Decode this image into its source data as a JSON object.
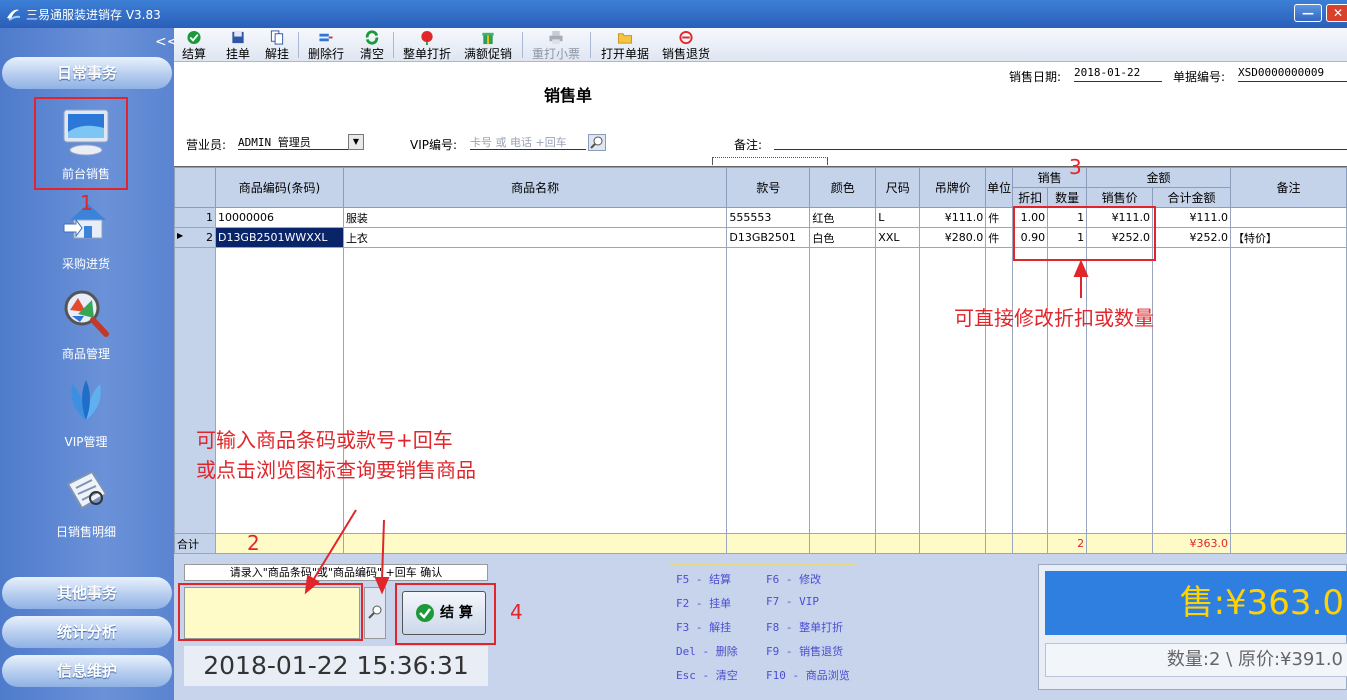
{
  "window": {
    "title": "三易通服装进销存 V3.83"
  },
  "sidebar": {
    "collapse": "<<",
    "headers": {
      "daily": "日常事务",
      "other": "其他事务",
      "stats": "统计分析",
      "info": "信息维护"
    },
    "items": [
      {
        "label": "前台销售",
        "icon": "monitor-icon"
      },
      {
        "label": "采购进货",
        "icon": "house-icon"
      },
      {
        "label": "商品管理",
        "icon": "magnifier-icon"
      },
      {
        "label": "VIP管理",
        "icon": "vip-leaf-icon"
      },
      {
        "label": "日销售明细",
        "icon": "report-icon"
      }
    ]
  },
  "toolbar": [
    {
      "label": "结算",
      "icon": "check-icon"
    },
    {
      "label": "挂单",
      "icon": "save-icon"
    },
    {
      "label": "解挂",
      "icon": "copy-icon"
    },
    {
      "label": "删除行",
      "icon": "delete-row-icon"
    },
    {
      "label": "清空",
      "icon": "refresh-icon"
    },
    {
      "label": "整单打折",
      "icon": "discount-icon"
    },
    {
      "label": "满额促销",
      "icon": "gift-icon"
    },
    {
      "label": "重打小票",
      "icon": "printer-icon",
      "disabled": true
    },
    {
      "label": "打开单据",
      "icon": "folder-icon"
    },
    {
      "label": "销售退货",
      "icon": "return-icon"
    }
  ],
  "form": {
    "title": "销售单",
    "date_label": "销售日期:",
    "date_value": "2018-01-22",
    "docno_label": "单据编号:",
    "docno_value": "XSD0000000009",
    "clerk_label": "营业员:",
    "clerk_value": "ADMIN 管理员",
    "vip_label": "VIP编号:",
    "vip_placeholder": "卡号 或 电话 +回车",
    "note_label": "备注:"
  },
  "grid": {
    "headers": {
      "code": "商品编码(条码)",
      "name": "商品名称",
      "style": "款号",
      "color": "颜色",
      "size": "尺码",
      "tag": "吊牌价",
      "unit": "单位",
      "sale": "销售",
      "discount": "折扣",
      "qty": "数量",
      "amount": "金额",
      "price": "销售价",
      "total": "合计金额",
      "remark": "备注"
    },
    "rows": [
      {
        "no": "1",
        "code": "10000006",
        "name": "服装",
        "style": "555553",
        "color": "红色",
        "size": "L",
        "tag": "¥111.0",
        "unit": "件",
        "discount": "1.00",
        "qty": "1",
        "price": "¥111.0",
        "total": "¥111.0",
        "remark": ""
      },
      {
        "no": "2",
        "code": "D13GB2501WWXXL",
        "name": "上衣",
        "style": "D13GB2501",
        "color": "白色",
        "size": "XXL",
        "tag": "¥280.0",
        "unit": "件",
        "discount": "0.90",
        "qty": "1",
        "price": "¥252.0",
        "total": "¥252.0",
        "remark": "【特价】"
      }
    ],
    "footer": {
      "label": "合计",
      "qty": "2",
      "total": "¥363.0"
    }
  },
  "bottom": {
    "prompt": "请录入\"商品条码\"或\"商品编码\" +回车 确认",
    "checkout_label": "结 算",
    "datetime": "2018-01-22 15:36:31",
    "hotkeys": [
      "F5 - 结算",
      "F6 - 修改",
      "F2 - 挂单",
      "F7 - VIP",
      "F3 - 解挂",
      "F8 - 整单打折",
      "Del - 删除",
      "F9 - 销售退货",
      "Esc - 清空",
      "F10 - 商品浏览"
    ],
    "total_display": "售:¥363.0",
    "summary_display": "数量:2 \\ 原价:¥391.0"
  },
  "annotations": {
    "n1": "1",
    "n2": "2",
    "n3": "3",
    "n4": "4",
    "edit_hint": "可直接修改折扣或数量",
    "input_hint1": "可输入商品条码或款号+回车",
    "input_hint2": "或点击浏览图标查询要销售商品"
  },
  "colors": {
    "accent": "#2a5fb8",
    "highlight_row": "#0a246a",
    "total_text": "#ffd200",
    "annotation": "#e0262a"
  }
}
